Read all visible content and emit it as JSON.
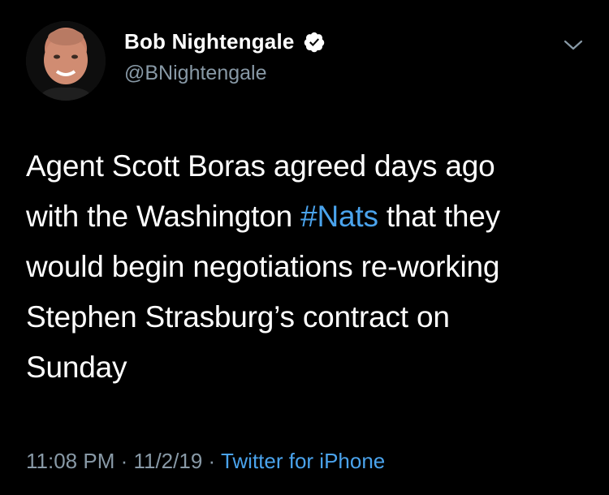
{
  "author": {
    "display_name": "Bob Nightengale",
    "handle": "@BNightengale",
    "verified": true,
    "avatar_icon": "profile-photo"
  },
  "tweet": {
    "lines": [
      {
        "segments": [
          {
            "text": "Agent Scott Boras agreed days ago",
            "type": "text"
          }
        ]
      },
      {
        "segments": [
          {
            "text": "with the Washington ",
            "type": "text"
          },
          {
            "text": "#Nats",
            "type": "hashtag"
          },
          {
            "text": " that they",
            "type": "text"
          }
        ]
      },
      {
        "segments": [
          {
            "text": "would begin negotiations re-working",
            "type": "text"
          }
        ]
      },
      {
        "segments": [
          {
            "text": "Stephen Strasburg’s contract on",
            "type": "text"
          }
        ]
      },
      {
        "segments": [
          {
            "text": "Sunday",
            "type": "text"
          }
        ]
      }
    ]
  },
  "meta": {
    "time": "11:08 PM",
    "separator": " · ",
    "date": "11/2/19",
    "source": "Twitter for iPhone"
  },
  "colors": {
    "background": "#000000",
    "text": "#ffffff",
    "secondary": "#8899a6",
    "link": "#4aa3ec"
  },
  "icons": {
    "verified": "verified-badge-icon",
    "more": "chevron-down-icon"
  }
}
